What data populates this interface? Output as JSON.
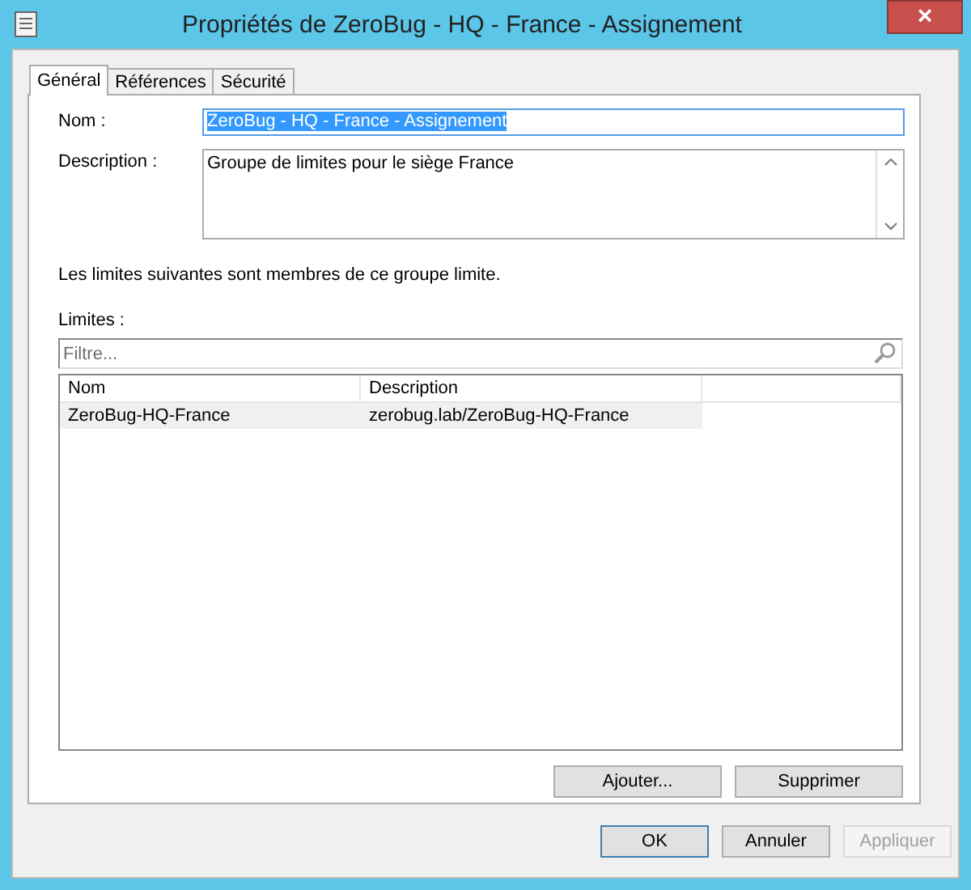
{
  "window": {
    "title": "Propriétés de ZeroBug - HQ - France - Assignement",
    "close": "×"
  },
  "tabs": [
    {
      "label": "Général",
      "selected": true
    },
    {
      "label": "Références",
      "selected": false
    },
    {
      "label": "Sécurité",
      "selected": false
    }
  ],
  "name_field": {
    "label": "Nom :",
    "value": "ZeroBug - HQ - France - Assignement",
    "text_selected": true
  },
  "description_field": {
    "label": "Description :",
    "value": "Groupe de limites pour le siège France"
  },
  "info_text": "Les limites suivantes sont membres de ce groupe limite.",
  "limits_label": "Limites :",
  "filter": {
    "placeholder": "Filtre..."
  },
  "table": {
    "columns": [
      "Nom",
      "Description"
    ],
    "rows": [
      {
        "cells": [
          "ZeroBug-HQ-France",
          "zerobug.lab/ZeroBug-HQ-France"
        ],
        "selected": false
      }
    ]
  },
  "list_buttons": [
    {
      "label": "Ajouter...",
      "disabled": false
    },
    {
      "label": "Supprimer",
      "disabled": false
    }
  ],
  "dialog_buttons": [
    {
      "label": "OK",
      "disabled": false,
      "default": true
    },
    {
      "label": "Annuler",
      "disabled": false,
      "default": false
    },
    {
      "label": "Appliquer",
      "disabled": true,
      "default": false
    }
  ]
}
